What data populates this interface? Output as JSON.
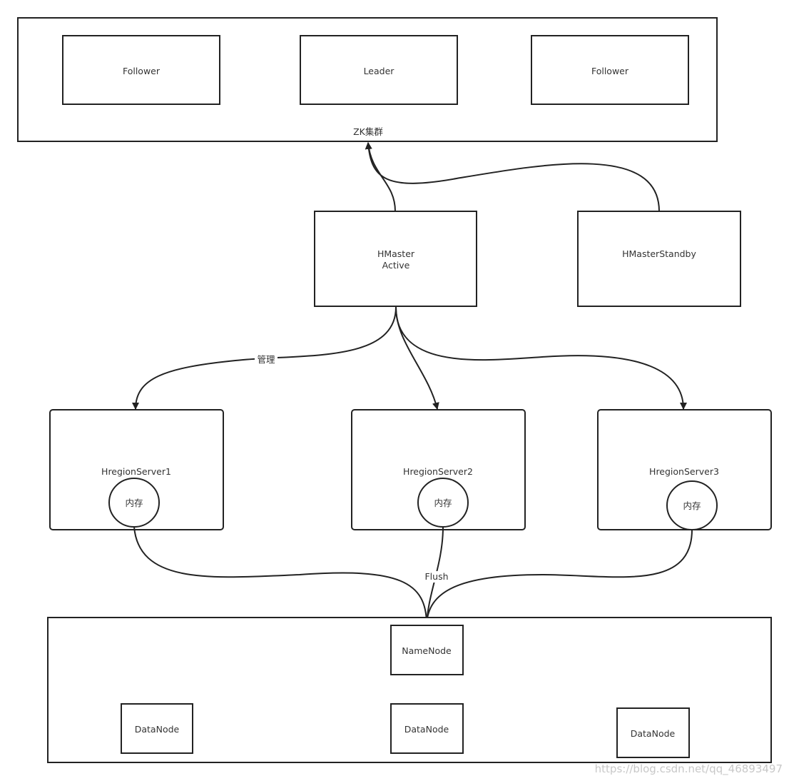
{
  "zk_cluster": {
    "label": "ZK集群",
    "nodes": [
      "Follower",
      "Leader",
      "Follower"
    ]
  },
  "hmaster": {
    "line1": "HMaster",
    "line2": "Active"
  },
  "hmaster_standby": {
    "label": "HMasterStandby"
  },
  "manage_label": "管理",
  "region_servers": [
    {
      "label": "HregionServer1",
      "memory": "内存"
    },
    {
      "label": "HregionServer2",
      "memory": "内存"
    },
    {
      "label": "HregionServer3",
      "memory": "内存"
    }
  ],
  "flush_label": "Flush",
  "hdfs": {
    "namenode": "NameNode",
    "datanodes": [
      "DataNode",
      "DataNode",
      "DataNode"
    ]
  },
  "watermark": "https://blog.csdn.net/qq_46893497"
}
